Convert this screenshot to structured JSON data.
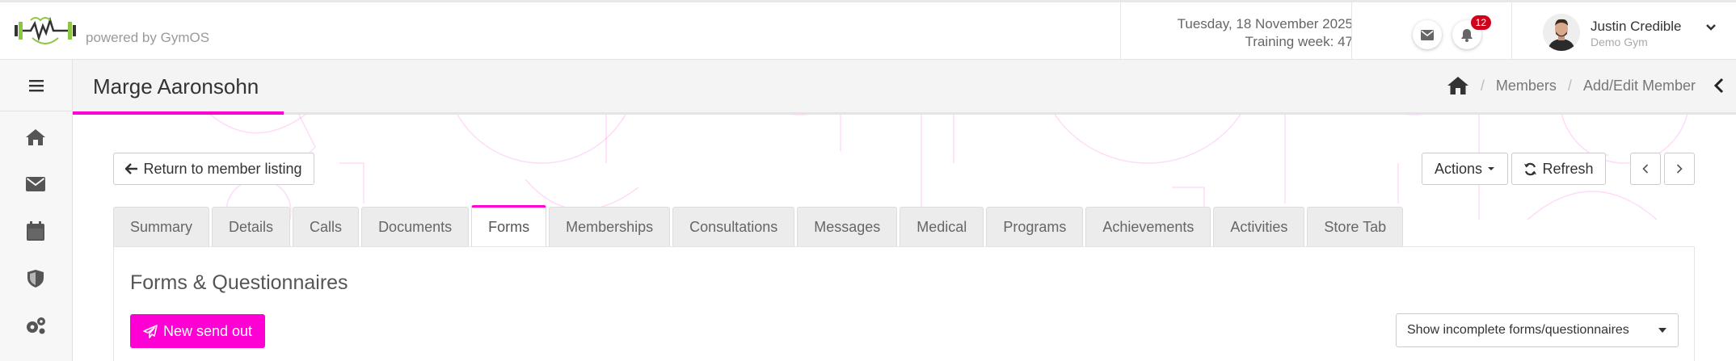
{
  "header": {
    "brand_text": "powered by GymOS",
    "date": "Tuesday, 18 November 2025",
    "training_week": "Training week: 47",
    "notifications_count": "12",
    "user": {
      "name": "Justin Credible",
      "gym": "Demo Gym"
    }
  },
  "sidebar": {
    "items": [
      {
        "icon": "home-icon"
      },
      {
        "icon": "envelope-icon"
      },
      {
        "icon": "calendar-icon"
      },
      {
        "icon": "shield-icon"
      },
      {
        "icon": "cogs-icon"
      }
    ]
  },
  "page": {
    "title": "Marge Aaronsohn",
    "breadcrumbs": [
      "Members",
      "Add/Edit Member"
    ]
  },
  "toolbar": {
    "return_label": "Return to member listing",
    "actions_label": "Actions",
    "refresh_label": "Refresh"
  },
  "tabs": [
    {
      "label": "Summary"
    },
    {
      "label": "Details"
    },
    {
      "label": "Calls"
    },
    {
      "label": "Documents"
    },
    {
      "label": "Forms",
      "active": true
    },
    {
      "label": "Memberships"
    },
    {
      "label": "Consultations"
    },
    {
      "label": "Messages"
    },
    {
      "label": "Medical"
    },
    {
      "label": "Programs"
    },
    {
      "label": "Achievements"
    },
    {
      "label": "Activities"
    },
    {
      "label": "Store Tab"
    }
  ],
  "forms_panel": {
    "title": "Forms & Questionnaires",
    "send_button": "New send out",
    "filter_selected": "Show incomplete forms/questionnaires"
  },
  "colors": {
    "accent": "#ff00d4",
    "badge": "#d0021b",
    "logo_green": "#8dc63f"
  }
}
